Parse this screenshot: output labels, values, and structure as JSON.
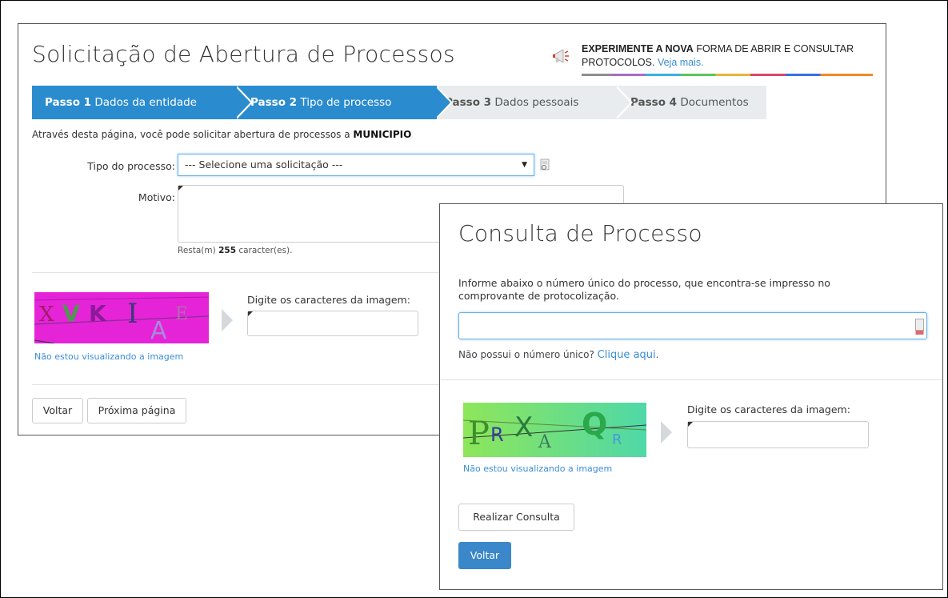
{
  "solicitacao": {
    "title": "Solicitação de Abertura de Processos",
    "promo": {
      "bold": "EXPERIMENTE A NOVA",
      "text": " FORMA DE ABRIR E CONSULTAR PROTOCOLOS.",
      "link": "Veja mais."
    },
    "steps": [
      {
        "num": "Passo 1",
        "label": "Dados da entidade",
        "active": true
      },
      {
        "num": "Passo 2",
        "label": "Tipo de processo",
        "active": true
      },
      {
        "num": "Passo 3",
        "label": "Dados pessoais",
        "active": false
      },
      {
        "num": "Passo 4",
        "label": "Documentos",
        "active": false
      }
    ],
    "intro": "Através desta página, você pode solicitar abertura de processos a ",
    "intro_entity": "MUNICIPIO",
    "tipo_label": "Tipo do processo:",
    "tipo_value": "--- Selecione uma solicitação ---",
    "motivo_label": "Motivo:",
    "resta_prefix": "Resta(m) ",
    "resta_count": "255",
    "resta_suffix": " caracter(es).",
    "captcha_label": "Digite os caracteres da imagem:",
    "captcha_chars": [
      "X",
      "V",
      "K",
      "I",
      "A",
      "E"
    ],
    "nao_visualizando": "Não estou visualizando a imagem",
    "btn_voltar": "Voltar",
    "btn_proxima": "Próxima página"
  },
  "consulta": {
    "title": "Consulta de Processo",
    "info": "Informe abaixo o número único do processo, que encontra-se impresso no comprovante de protocolização.",
    "nao_possui": "Não possui o número único? ",
    "clique_aqui": "Clique aqui",
    "clique_suffix": ".",
    "captcha_label": "Digite os caracteres da imagem:",
    "captcha_chars": [
      "P",
      "R",
      "X",
      "A",
      "Q",
      "R"
    ],
    "nao_visualizando": "Não estou visualizando a imagem",
    "btn_realizar": "Realizar Consulta",
    "btn_voltar": "Voltar"
  },
  "colors": {
    "accent": "#2a8ccf",
    "link": "#3a8dd6",
    "step_inactive": "#e8ecee",
    "primary_button": "#3a87c9",
    "captcha1_bg": "#e524d8",
    "captcha2_bg": "#6ee08a"
  }
}
